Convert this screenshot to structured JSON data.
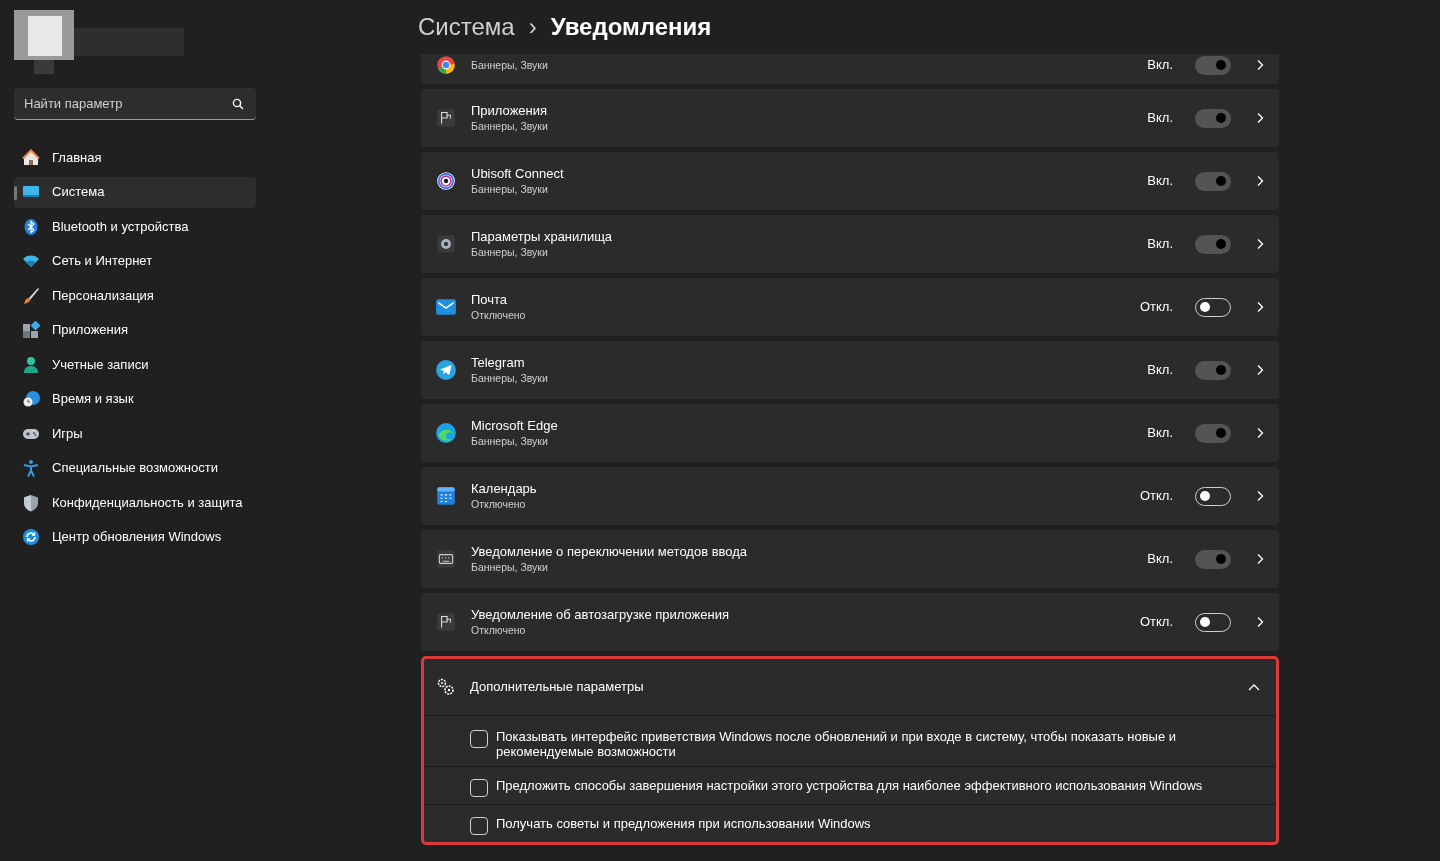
{
  "sidebar": {
    "search": {
      "placeholder": "Найти параметр"
    },
    "items": [
      {
        "label": "Главная",
        "selected": false
      },
      {
        "label": "Система",
        "selected": true
      },
      {
        "label": "Bluetooth и устройства",
        "selected": false
      },
      {
        "label": "Сеть и Интернет",
        "selected": false
      },
      {
        "label": "Персонализация",
        "selected": false
      },
      {
        "label": "Приложения",
        "selected": false
      },
      {
        "label": "Учетные записи",
        "selected": false
      },
      {
        "label": "Время и язык",
        "selected": false
      },
      {
        "label": "Игры",
        "selected": false
      },
      {
        "label": "Специальные возможности",
        "selected": false
      },
      {
        "label": "Конфиденциальность и защита",
        "selected": false
      },
      {
        "label": "Центр обновления Windows",
        "selected": false
      }
    ]
  },
  "breadcrumb": {
    "parent": "Система",
    "separator": "›",
    "current": "Уведомления"
  },
  "apps": [
    {
      "subtitle": "Баннеры, Звуки",
      "state": "Вкл.",
      "on": true
    },
    {
      "title": "Приложения",
      "subtitle": "Баннеры, Звуки",
      "state": "Вкл.",
      "on": true
    },
    {
      "title": "Ubisoft Connect",
      "subtitle": "Баннеры, Звуки",
      "state": "Вкл.",
      "on": true
    },
    {
      "title": "Параметры хранилища",
      "subtitle": "Баннеры, Звуки",
      "state": "Вкл.",
      "on": true
    },
    {
      "title": "Почта",
      "subtitle": "Отключено",
      "state": "Откл.",
      "on": false
    },
    {
      "title": "Telegram",
      "subtitle": "Баннеры, Звуки",
      "state": "Вкл.",
      "on": true
    },
    {
      "title": "Microsoft Edge",
      "subtitle": "Баннеры, Звуки",
      "state": "Вкл.",
      "on": true
    },
    {
      "title": "Календарь",
      "subtitle": "Отключено",
      "state": "Откл.",
      "on": false
    },
    {
      "title": "Уведомление о переключении методов ввода",
      "subtitle": "Баннеры, Звуки",
      "state": "Вкл.",
      "on": true
    },
    {
      "title": "Уведомление об автозагрузке приложения",
      "subtitle": "Отключено",
      "state": "Откл.",
      "on": false
    }
  ],
  "additional": {
    "title": "Дополнительные параметры",
    "expanded": true,
    "highlighted": true,
    "options": [
      {
        "label": "Показывать интерфейс приветствия Windows после обновлений и при входе в систему, чтобы показать новые и рекомендуемые возможности",
        "checked": false
      },
      {
        "label": "Предложить способы завершения настройки этого устройства для наиболее эффективного использования Windows",
        "checked": false
      },
      {
        "label": "Получать советы и предложения при использовании Windows",
        "checked": false
      }
    ]
  }
}
